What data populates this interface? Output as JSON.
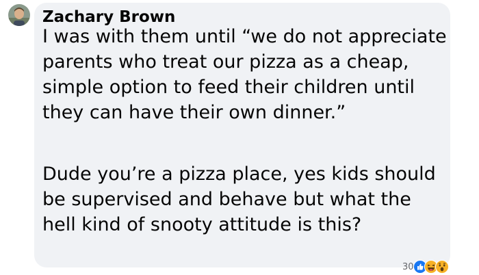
{
  "comment": {
    "author_name": "Zachary Brown",
    "paragraphs": [
      "I was with them until “we do not appreciate parents who treat our pizza as a cheap, simple option to feed their children until they can have their own dinner.”",
      "Dude you’re a pizza place, yes kids should be supervised and behave but what the hell kind of snooty attitude is this?"
    ],
    "reactions": {
      "count": "30",
      "icons": [
        "like-icon",
        "haha-icon",
        "wow-icon"
      ]
    }
  },
  "colors": {
    "bubble_background": "#f0f2f5",
    "text": "#050505",
    "muted_text": "#65676b",
    "like_blue": "#1877f2",
    "emoji_yellow": "#f7b125"
  }
}
